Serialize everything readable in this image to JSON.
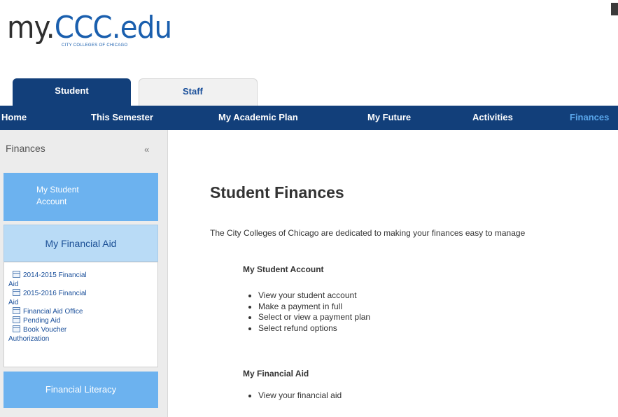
{
  "logo": {
    "part_a": "my.",
    "part_b": "CCC.edu",
    "subtitle": "CITY COLLEGES OF CHICAGO"
  },
  "role_tabs": [
    "Student",
    "Staff"
  ],
  "nav": [
    "Home",
    "This Semester",
    "My Academic Plan",
    "My Future",
    "Activities",
    "Finances"
  ],
  "sidebar": {
    "title": "Finances",
    "collapse_icon": "«",
    "student_account": {
      "line1": "My Student",
      "line2": "Account"
    },
    "financial_aid": "My Financial Aid",
    "aid_links": [
      {
        "line1": "2014-2015 Financial",
        "line2": "Aid"
      },
      {
        "line1": "2015-2016 Financial",
        "line2": "Aid"
      },
      {
        "line1": "Financial Aid Office",
        "line2": ""
      },
      {
        "line1": "Pending Aid",
        "line2": ""
      },
      {
        "line1": "Book Voucher",
        "line2": "Authorization"
      }
    ],
    "financial_literacy": "Financial Literacy"
  },
  "main": {
    "title": "Student Finances",
    "intro": "The City Colleges of Chicago are dedicated to making your finances easy to manage",
    "account_section": {
      "heading": "My Student Account",
      "items": [
        "View your student account",
        "Make a payment in full",
        "Select or view a payment plan",
        "Select refund options"
      ]
    },
    "aid_section": {
      "heading": "My Financial Aid",
      "items": [
        "View your financial aid"
      ]
    }
  },
  "colors": {
    "nav_bg": "#123f7a",
    "active_nav": "#5aa7ec",
    "sidebar_button": "#6cb2ef",
    "selected_button": "#b9dbf6"
  }
}
